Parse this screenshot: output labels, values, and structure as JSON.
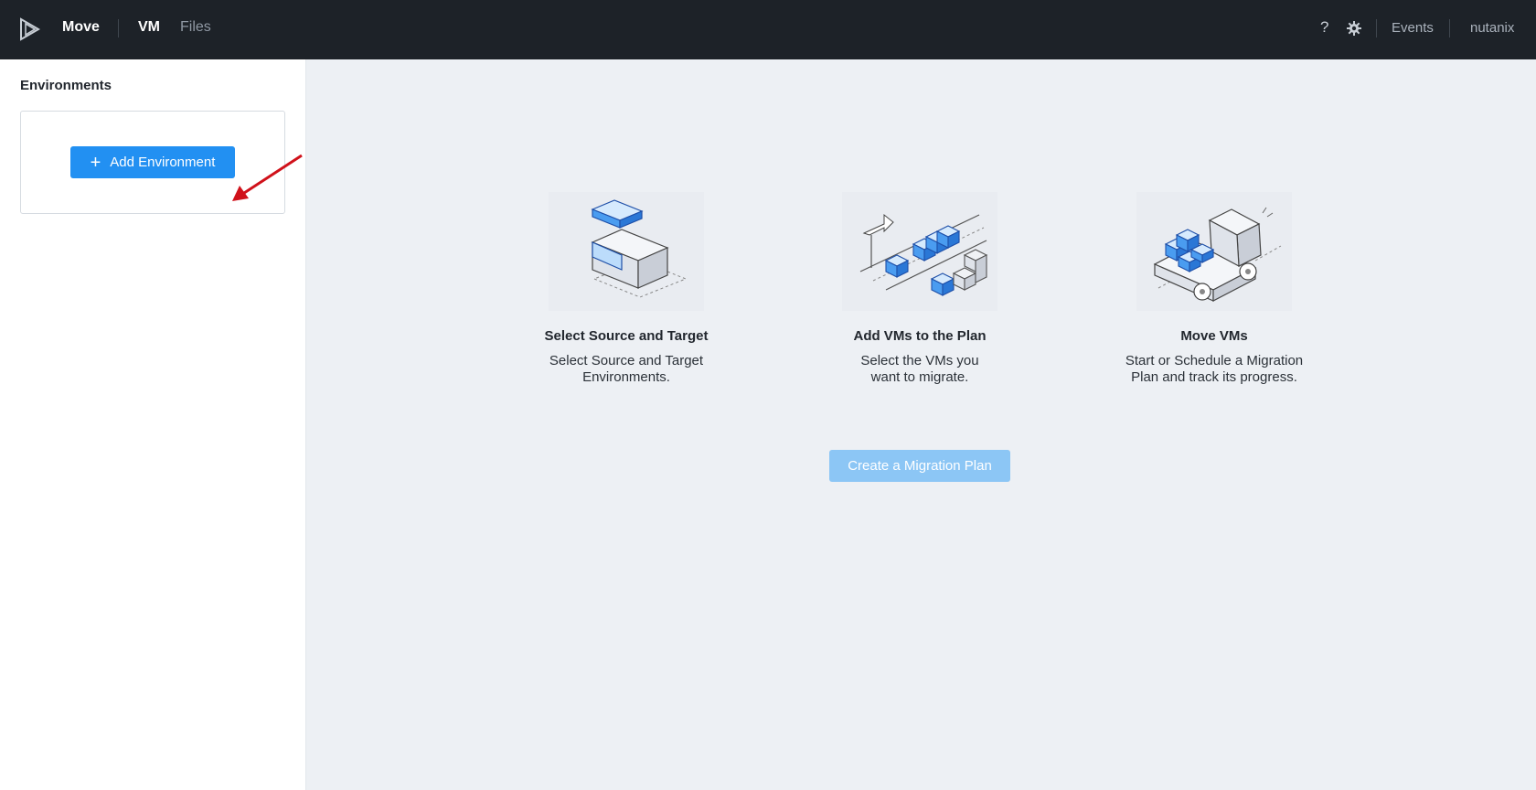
{
  "header": {
    "app_name": "Move",
    "tabs": [
      {
        "label": "VM",
        "active": true
      },
      {
        "label": "Files",
        "active": false
      }
    ],
    "help_label": "?",
    "events_label": "Events",
    "user_label": "nutanix"
  },
  "sidebar": {
    "title": "Environments",
    "add_button_label": "Add Environment"
  },
  "main": {
    "steps": [
      {
        "title": "Select Source and Target",
        "desc_line1": "Select Source and Target",
        "desc_line2": "Environments."
      },
      {
        "title": "Add VMs to the Plan",
        "desc_line1": "Select the VMs you",
        "desc_line2": "want to migrate."
      },
      {
        "title": "Move VMs",
        "desc_line1": "Start or Schedule a Migration",
        "desc_line2": "Plan and track its progress."
      }
    ],
    "create_button_label": "Create a Migration Plan"
  },
  "colors": {
    "topbar": "#1d2228",
    "primary": "#2290f2",
    "primary_disabled": "#8cc6f5",
    "main_bg": "#edf0f4",
    "annotation_arrow": "#d0111a"
  }
}
